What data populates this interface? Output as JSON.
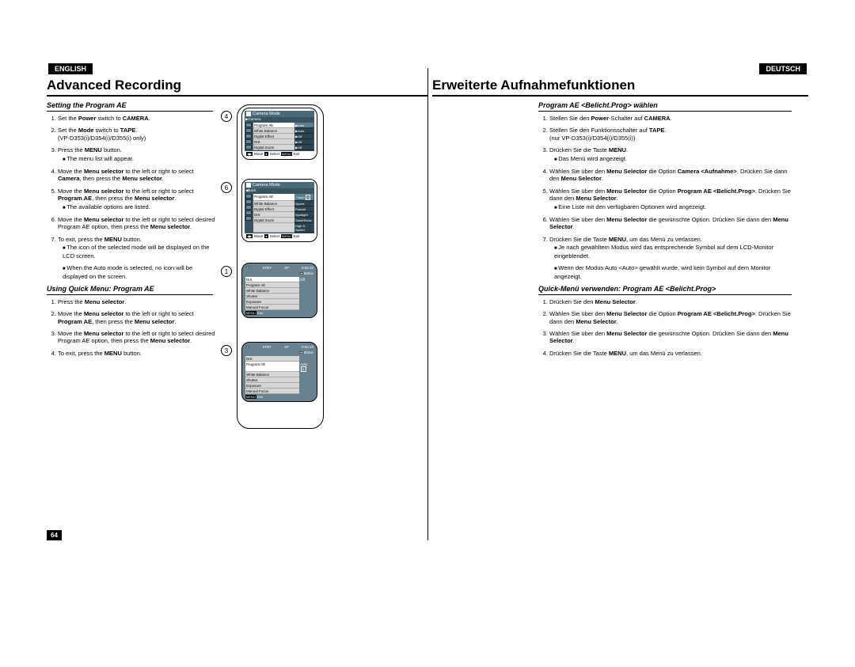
{
  "lang_left": "ENGLISH",
  "lang_right": "DEUTSCH",
  "title_left": "Advanced Recording",
  "title_right": "Erweiterte Aufnahmefunktionen",
  "page_number": "64",
  "circled": {
    "a": "4",
    "b": "6",
    "c": "1",
    "d": "3"
  },
  "left": {
    "section1": "Setting the Program AE",
    "steps1": {
      "s1a": "Set the ",
      "s1b": "Power",
      "s1c": " switch to ",
      "s1d": "CAMERA",
      "s1e": ".",
      "s2a": "Set the ",
      "s2b": "Mode",
      "s2c": " switch to ",
      "s2d": "TAPE",
      "s2e": ".",
      "s2note": "(VP-D353(i)/D354(i)/D355(i) only)",
      "s3a": "Press the ",
      "s3b": "MENU",
      "s3c": " button.",
      "s3sub": "The menu list will appear.",
      "s4a": "Move the ",
      "s4b": "Menu selector",
      "s4c": " to the left or right to select ",
      "s4d": "Camera",
      "s4e": ", then press the ",
      "s4f": "Menu selector",
      "s4g": ".",
      "s5a": "Move the ",
      "s5b": "Menu selector",
      "s5c": " to the left or right to select ",
      "s5d": "Program AE",
      "s5e": ", then press the ",
      "s5f": "Menu selector",
      "s5g": ".",
      "s5sub": "The available options are listed.",
      "s6a": "Move the ",
      "s6b": "Menu selector",
      "s6c": " to the left or right to select desired Program AE option, then press the ",
      "s6d": "Menu selector",
      "s6e": ".",
      "s7a": "To exit, press the ",
      "s7b": "MENU",
      "s7c": " button.",
      "s7sub1": "The icon of the selected mode will be displayed on the LCD screen.",
      "s7sub2": "When the Auto mode is selected, no icon will be displayed on the screen."
    },
    "section2": "Using Quick Menu: Program AE",
    "steps2": {
      "s1a": "Press the ",
      "s1b": "Menu selector",
      "s1c": ".",
      "s2a": "Move the ",
      "s2b": "Menu selector",
      "s2c": " to the left or right to select ",
      "s2d": "Program AE",
      "s2e": ", then press the ",
      "s2f": "Menu selector",
      "s2g": ".",
      "s3a": "Move the ",
      "s3b": "Menu selector",
      "s3c": " to the left or right to select desired Program AE option, then press the ",
      "s3d": "Menu selector",
      "s3e": ".",
      "s4a": "To exit, press the ",
      "s4b": "MENU",
      "s4c": " button."
    }
  },
  "right": {
    "section1": "Program AE <Belicht.Prog> wählen",
    "steps1": {
      "s1a": "Stellen Sie den ",
      "s1b": "Power",
      "s1c": "-Schalter auf ",
      "s1d": "CAMERA",
      "s1e": ".",
      "s2a": "Stellen Sie den Funktionsschalter auf ",
      "s2b": "TAPE",
      "s2c": ".",
      "s2note": "(nur VP-D353(i)/D354(i)/D355(i))",
      "s3a": "Drücken Sie die Taste ",
      "s3b": "MENU",
      "s3c": ".",
      "s3sub": "Das Menü wird angezeigt.",
      "s4a": "Wählen Sie über den ",
      "s4b": "Menu Selector",
      "s4c": " die Option ",
      "s4d": "Camera <Aufnahme>",
      "s4e": ". Drücken Sie dann den ",
      "s4f": "Menu Selector",
      "s4g": ".",
      "s5a": "Wählen Sie über den ",
      "s5b": "Menu Selector",
      "s5c": " die Option ",
      "s5d": "Program AE <Belicht.Prog>",
      "s5e": ". Drücken Sie dann den ",
      "s5f": "Menu Selector",
      "s5g": ".",
      "s5sub": "Eine Liste mit den verfügbaren Optionen wird angezeigt.",
      "s6a": "Wählen Sie über den ",
      "s6b": "Menu Selector",
      "s6c": " die gewünschte Option. Drücken Sie dann den ",
      "s6d": "Menu Selector",
      "s6e": ".",
      "s7a": "Drücken Sie die Taste ",
      "s7b": "MENU",
      "s7c": ", um das Menü zu verlassen.",
      "s7sub1": "Je nach gewähltem Modus wird das entsprechende Symbol auf dem LCD-Monitor eingeblendet.",
      "s7sub2": "Wenn der Modus Auto <Auto> gewählt wurde, wird kein Symbol auf dem Monitor angezeigt."
    },
    "section2": "Quick-Menü verwenden: Program AE <Belicht.Prog>",
    "steps2": {
      "s1a": "Drücken Sie den ",
      "s1b": "Menu Selector",
      "s1c": ".",
      "s2a": "Wählen Sie über den ",
      "s2b": "Menu Selector",
      "s2c": " die Option ",
      "s2d": "Program AE <Belicht.Prog>",
      "s2e": ". Drücken Sie dann den ",
      "s2f": "Menu Selector",
      "s2g": ".",
      "s3a": "Wählen Sie über den ",
      "s3b": "Menu Selector",
      "s3c": " die gewünschte Option. Drücken Sie dann den ",
      "s3d": "Menu Selector",
      "s3e": ".",
      "s4a": "Drücken Sie die Taste ",
      "s4b": "MENU",
      "s4c": ", um das Menü zu verlassen."
    }
  },
  "screens": {
    "menu_title": "Camera Mode",
    "back": "Back",
    "camera": "Camera",
    "rows": {
      "program_ae": "Program AE",
      "auto": "Auto",
      "white_balance": "White Balance",
      "wb_auto": "Auto",
      "digital_effect": "Digital Effect",
      "off": "Off",
      "dis": "DIS",
      "dis_off": "Off",
      "digital_zoom": "Digital Zoom",
      "dz_off": "Off"
    },
    "opts": {
      "auto": "Auto",
      "sports": "Sports",
      "portrait": "Portrait",
      "spotlight": "Spotlight",
      "sandsnow": "Sand/Snow",
      "hss": "High S. Speed"
    },
    "foot": {
      "move": "Move",
      "select": "Select",
      "exit": "Exit",
      "menu": "MENU"
    },
    "stby": "STBY",
    "time": "0:00:10",
    "remain": "60min",
    "quick": {
      "dis": "DIS",
      "dis_off": "Off",
      "program_ae": "Program AE",
      "auto": "Auto",
      "white_balance": "White Balance",
      "shutter": "Shutter",
      "exposure": "Exposure",
      "manual_focus": "Manual Focus"
    },
    "a_badge": "A"
  }
}
